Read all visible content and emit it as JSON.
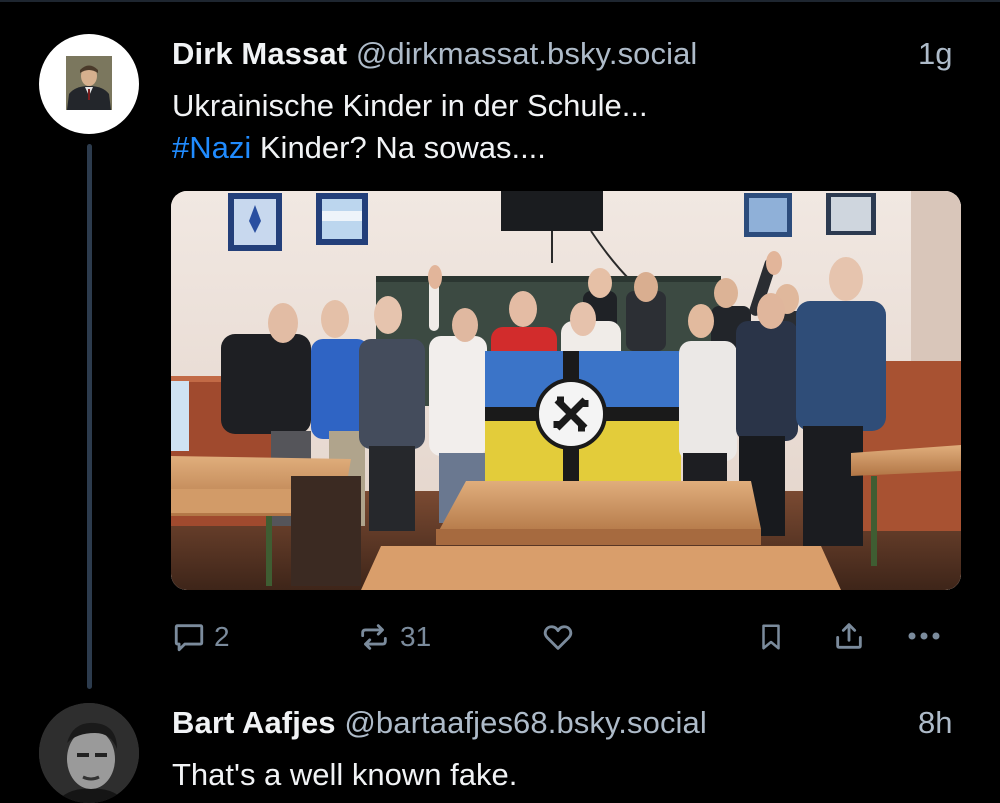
{
  "post1": {
    "author_name": "Dirk Massat",
    "author_handle": "@dirkmassat.bsky.social",
    "time": "1g",
    "text_line1": "Ukrainische Kinder in der Schule...",
    "hashtag": "#Nazi",
    "text_line2_rest": " Kinder? Na sowas....",
    "avatar_icon": "person-in-suit-photo",
    "image_icon": "classroom-photo",
    "actions": {
      "reply_count": "2",
      "repost_count": "31"
    }
  },
  "post2": {
    "author_name": "Bart Aafjes",
    "author_handle": "@bartaafjes68.bsky.social",
    "time": "8h",
    "text": "That's a well known fake.",
    "avatar_icon": "bw-portrait-photo"
  },
  "colors": {
    "background": "#000000",
    "text": "#f1f3f5",
    "muted": "#aebbc9",
    "icon": "#7b8b9c",
    "hashtag": "#208bfe",
    "thread_line": "#2c3b4d"
  }
}
